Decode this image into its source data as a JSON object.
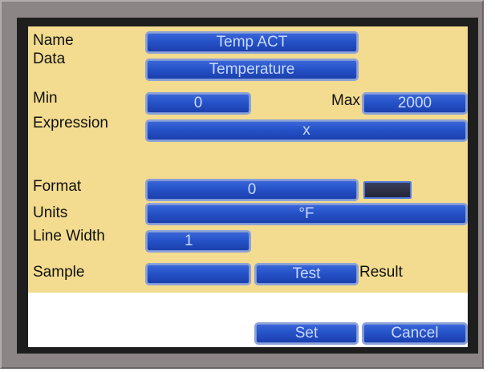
{
  "labels": {
    "name": "Name",
    "data": "Data",
    "min": "Min",
    "max": "Max",
    "expression": "Expression",
    "format": "Format",
    "units": "Units",
    "line_width": "Line Width",
    "sample": "Sample",
    "result": "Result"
  },
  "fields": {
    "name": "Temp ACT",
    "data": "Temperature",
    "min": "0",
    "max": "2000",
    "expression": "x",
    "format": "0",
    "units": "°F",
    "line_width": "1",
    "sample": ""
  },
  "buttons": {
    "test": "Test",
    "set": "Set",
    "cancel": "Cancel"
  },
  "colors": {
    "panel_background": "#f3dc8f",
    "button_blue": "#2552c8",
    "button_text": "#c9d8ff",
    "format_color_swatch": "#2b2d44"
  }
}
